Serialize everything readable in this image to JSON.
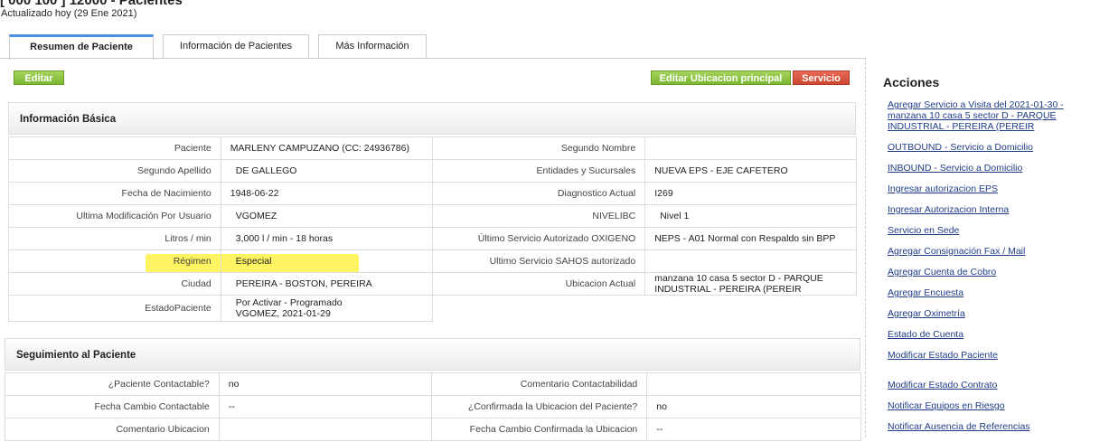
{
  "header": {
    "title_partial": "[ 000 100 ] 12000 - Pacientes",
    "updated": "Actualizado hoy (29 Ene 2021)"
  },
  "tabs": [
    {
      "label": "Resumen de Paciente",
      "active": true
    },
    {
      "label": "Información de Pacientes",
      "active": false
    },
    {
      "label": "Más Información",
      "active": false
    }
  ],
  "buttons": {
    "edit": "Editar",
    "edit_location": "Editar Ubicacion principal",
    "service": "Servicio"
  },
  "basic_info": {
    "title": "Información Básica",
    "rows": [
      {
        "l1": "Paciente",
        "v1": "MARLENY CAMPUZANO (CC: 24936786)",
        "l2": "Segundo Nombre",
        "v2": ""
      },
      {
        "l1": "Segundo Apellido",
        "v1": "DE GALLEGO",
        "l2": "Entidades y Sucursales",
        "v2": "NUEVA EPS - EJE CAFETERO"
      },
      {
        "l1": "Fecha de Nacimiento",
        "v1": "1948-06-22",
        "l2": "Diagnostico Actual",
        "v2": "I269"
      },
      {
        "l1": "Ultima Modificación Por Usuario",
        "v1": "VGOMEZ",
        "l2": "NIVELIBC",
        "v2": "Nivel 1"
      },
      {
        "l1": "Litros / min",
        "v1": "3,000 l / min - 18 horas",
        "l2": "Último Servicio Autorizado OXIGENO",
        "v2": "NEPS - A01 Normal con Respaldo sin BPP"
      },
      {
        "l1": "Régimen",
        "v1": "Especial",
        "l2": "Ultimo Servicio SAHOS autorizado",
        "v2": ""
      },
      {
        "l1": "Ciudad",
        "v1": "PEREIRA - BOSTON, PEREIRA",
        "l2": "Ubicacion Actual",
        "v2": "manzana 10 casa 5 sector D - PARQUE INDUSTRIAL - PEREIRA (PEREIR"
      },
      {
        "l1": "EstadoPaciente",
        "v1": "Por Activar - Programado\nVGOMEZ, 2021-01-29"
      }
    ]
  },
  "followup": {
    "title": "Seguimiento al Paciente",
    "rows": [
      {
        "l1": "¿Paciente Contactable?",
        "v1": "no",
        "l2": "Comentario Contactabilidad",
        "v2": ""
      },
      {
        "l1": "Fecha Cambio Contactable",
        "v1": "--",
        "l2": "¿Confirmada la Ubicacion del Paciente?",
        "v2": "no"
      },
      {
        "l1": "Comentario Ubicacion",
        "v1": "",
        "l2": "Fecha Cambio Confirmada la Ubicacion",
        "v2": "--"
      }
    ]
  },
  "actions": {
    "title": "Acciones",
    "items": [
      "Agregar Servicio a Visita del 2021-01-30 - manzana 10 casa 5 sector D - PARQUE INDUSTRIAL - PEREIRA (PEREIR",
      "OUTBOUND - Servicio a Domicilio",
      "INBOUND - Servicio a Domicilio",
      "Ingresar autorizacion EPS",
      "Ingresar Autorizacion Interna",
      "Servicio en Sede",
      "Agregar Consignación Fax / Mail",
      "Agregar Cuenta de Cobro",
      "Agregar Encuesta",
      "Agregar Oximetría",
      "Estado de Cuenta",
      "Modificar Estado Paciente",
      "Modificar Estado Contrato",
      "Notificar Equipos en Riesgo",
      "Notificar Ausencia de Referencias"
    ]
  }
}
